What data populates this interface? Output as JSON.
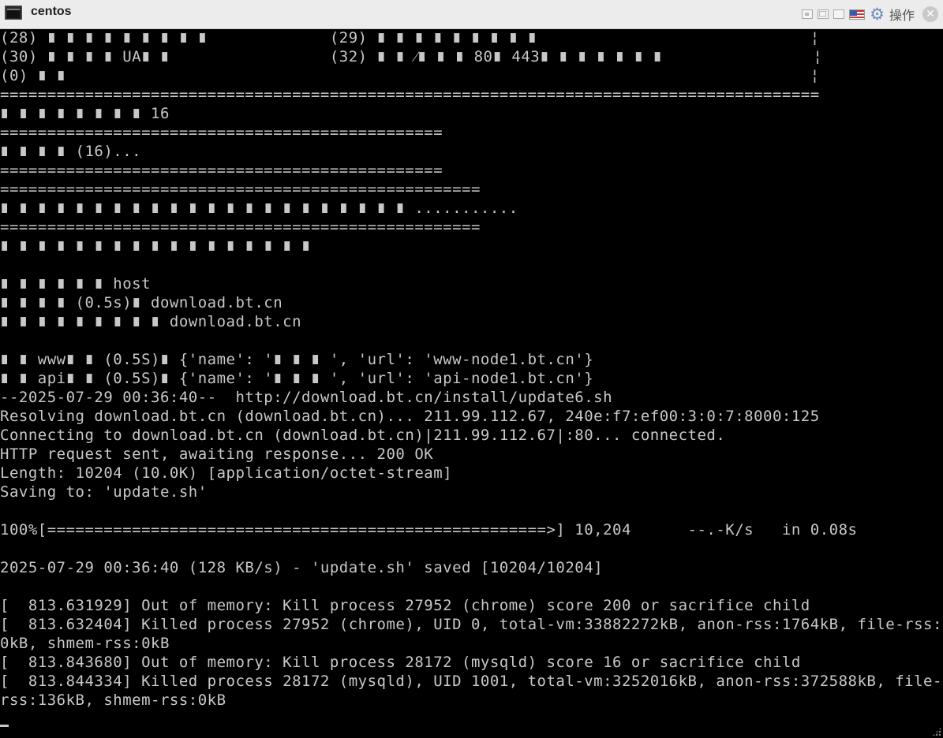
{
  "window": {
    "title": "centos",
    "faded_text": [
      "",
      ""
    ],
    "icons": {
      "app": "terminal-icon",
      "minimize": "minimize-icon",
      "restore": "restore-icon",
      "maximize": "maximize-icon",
      "language": "us-flag-icon",
      "settings": "gear-icon",
      "close": "close-icon"
    },
    "operations_label": "操作",
    "close_glyph": "✕",
    "gear_glyph": "⚙"
  },
  "terminal": {
    "lines": [
      "(28) ∎ ∎ ∎ ∎ ∎ ∎ ∎ ∎ ∎             (29) ∎ ∎ ∎ ∎ ∎ ∎ ∎ ∎ ∎                             ¦",
      "(30) ∎ ∎ ∎ ∎ UA∎ ∎                 (32) ∎ ∎ ⁄∎ ∎ ∎ 80∎ 443∎ ∎ ∎ ∎ ∎ ∎ ∎                ¦",
      "(0) ∎ ∎                                                                               ¦",
      "=======================================================================================",
      "∎ ∎ ∎ ∎ ∎ ∎ ∎ ∎ 16",
      "===============================================",
      "∎ ∎ ∎ ∎ (16)...",
      "===============================================",
      "===================================================",
      "∎ ∎ ∎ ∎ ∎ ∎ ∎ ∎ ∎ ∎ ∎ ∎ ∎ ∎ ∎ ∎ ∎ ∎ ∎ ∎ ∎ ∎ ...........",
      "===================================================",
      "∎ ∎ ∎ ∎ ∎ ∎ ∎ ∎ ∎ ∎ ∎ ∎ ∎ ∎ ∎ ∎ ∎",
      "",
      "∎ ∎ ∎ ∎ ∎ ∎ host",
      "∎ ∎ ∎ ∎ (0.5s)∎ download.bt.cn",
      "∎ ∎ ∎ ∎ ∎ ∎ ∎ ∎ ∎ download.bt.cn",
      "",
      "∎ ∎ www∎ ∎ (0.5S)∎ {'name': '∎ ∎ ∎ ', 'url': 'www-node1.bt.cn'}",
      "∎ ∎ api∎ ∎ (0.5S)∎ {'name': '∎ ∎ ∎ ', 'url': 'api-node1.bt.cn'}",
      "--2025-07-29 00:36:40--  http://download.bt.cn/install/update6.sh",
      "Resolving download.bt.cn (download.bt.cn)... 211.99.112.67, 240e:f7:ef00:3:0:7:8000:125",
      "Connecting to download.bt.cn (download.bt.cn)|211.99.112.67|:80... connected.",
      "HTTP request sent, awaiting response... 200 OK",
      "Length: 10204 (10.0K) [application/octet-stream]",
      "Saving to: 'update.sh'",
      "",
      "100%[=====================================================>] 10,204      --.-K/s   in 0.08s",
      "",
      "2025-07-29 00:36:40 (128 KB/s) - 'update.sh' saved [10204/10204]",
      "",
      "[  813.631929] Out of memory: Kill process 27952 (chrome) score 200 or sacrifice child",
      "[  813.632404] Killed process 27952 (chrome), UID 0, total-vm:33882272kB, anon-rss:1764kB, file-rss:",
      "0kB, shmem-rss:0kB",
      "[  813.843680] Out of memory: Kill process 28172 (mysqld) score 16 or sacrifice child",
      "[  813.844334] Killed process 28172 (mysqld), UID 1001, total-vm:3252016kB, anon-rss:372588kB, file-",
      "rss:136kB, shmem-rss:0kB"
    ]
  }
}
